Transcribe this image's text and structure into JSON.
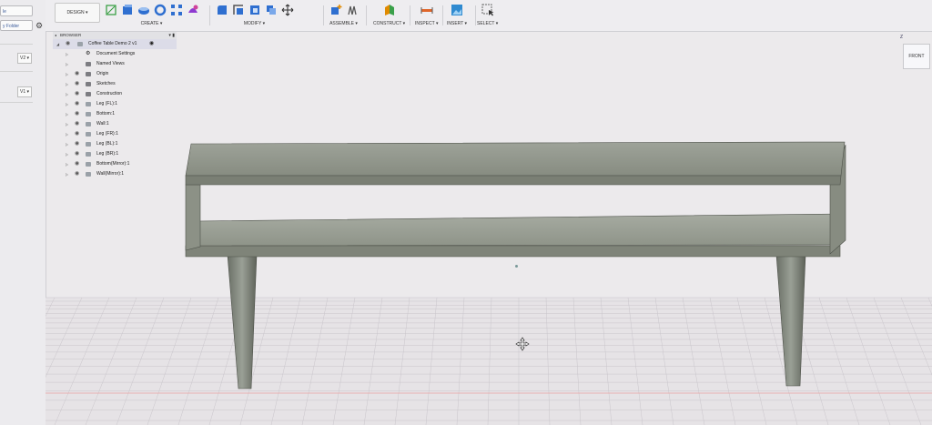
{
  "left_panel": {
    "button_top": "le",
    "button_folder": "y Folder",
    "select_1": "V2",
    "select_2": "V1"
  },
  "toolbar": {
    "workspace": "DESIGN",
    "groups": [
      {
        "label": "CREATE"
      },
      {
        "label": "MODIFY"
      },
      {
        "label": "ASSEMBLE"
      },
      {
        "label": "CONSTRUCT"
      },
      {
        "label": "INSPECT"
      },
      {
        "label": "INSERT"
      },
      {
        "label": "SELECT"
      }
    ]
  },
  "browser": {
    "title": "BROWSER",
    "root": "Coffee Table Demo 2 v1",
    "items": [
      {
        "label": "Document Settings",
        "type": "gear"
      },
      {
        "label": "Named Views",
        "type": "folder"
      },
      {
        "label": "Origin",
        "type": "folder"
      },
      {
        "label": "Sketches",
        "type": "folder"
      },
      {
        "label": "Construction",
        "type": "folder"
      },
      {
        "label": "Leg (FL):1",
        "type": "body"
      },
      {
        "label": "Bottom:1",
        "type": "body"
      },
      {
        "label": "Wall:1",
        "type": "body"
      },
      {
        "label": "Leg (FR):1",
        "type": "body"
      },
      {
        "label": "Leg (BL):1",
        "type": "body"
      },
      {
        "label": "Leg (BR):1",
        "type": "body"
      },
      {
        "label": "Bottom(Mirror):1",
        "type": "body"
      },
      {
        "label": "Wall(Mirror):1",
        "type": "body"
      }
    ]
  },
  "viewcube": {
    "face": "FRONT",
    "axis": "Z"
  },
  "colors": {
    "model_face": "#8e9388",
    "model_edge": "#4d5149",
    "grid": "#c9c5cb",
    "background": "#eceaec"
  }
}
